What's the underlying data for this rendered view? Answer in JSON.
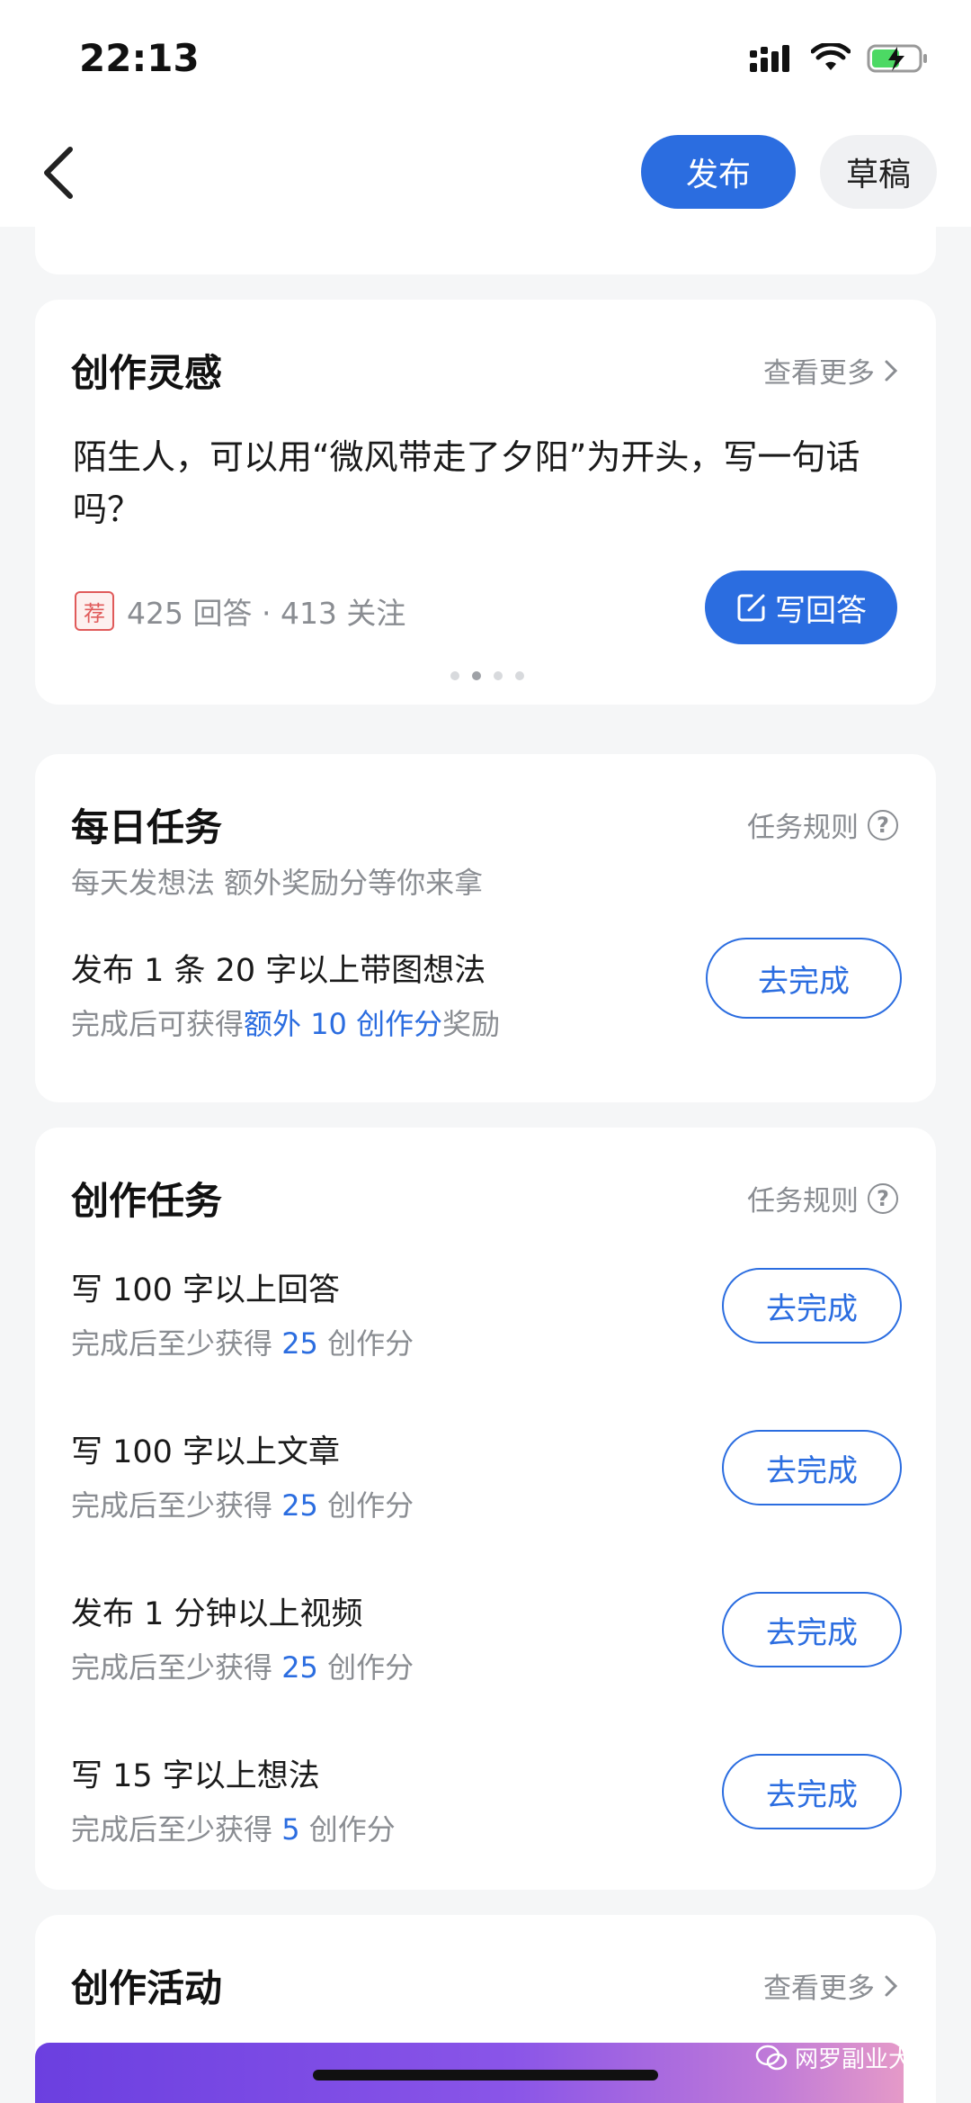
{
  "status_bar": {
    "time": "22:13"
  },
  "nav": {
    "publish_label": "发布",
    "draft_label": "草稿"
  },
  "inspiration": {
    "title": "创作灵感",
    "more_label": "查看更多",
    "question": "陌生人，可以用“微风带走了夕阳”为开头，写一句话吗？",
    "badge": "荐",
    "stats": "425 回答 · 413 关注",
    "write_answer_label": "写回答"
  },
  "daily_tasks": {
    "title": "每日任务",
    "rules_label": "任务规则",
    "subtitle": "每天发想法 额外奖励分等你来拿",
    "task": {
      "title": "发布 1 条 20 字以上带图想法",
      "desc_prefix": "完成后可获得",
      "desc_highlight": "额外 10 创作分",
      "desc_suffix": "奖励",
      "button": "去完成"
    }
  },
  "creation_tasks": {
    "title": "创作任务",
    "rules_label": "任务规则",
    "desc_prefix": "完成后至少获得",
    "desc_suffix": "创作分",
    "items": [
      {
        "title": "写 100 字以上回答",
        "points": "25",
        "button": "去完成"
      },
      {
        "title": "写 100 字以上文章",
        "points": "25",
        "button": "去完成"
      },
      {
        "title": "发布 1 分钟以上视频",
        "points": "25",
        "button": "去完成"
      },
      {
        "title": "写 15 字以上想法",
        "points": "5",
        "button": "去完成"
      }
    ]
  },
  "activities": {
    "title": "创作活动",
    "more_label": "查看更多"
  },
  "watermark": "网罗副业大全",
  "colors": {
    "accent": "#2b6de0",
    "background": "#f5f6f7",
    "muted": "#8a8d92"
  }
}
